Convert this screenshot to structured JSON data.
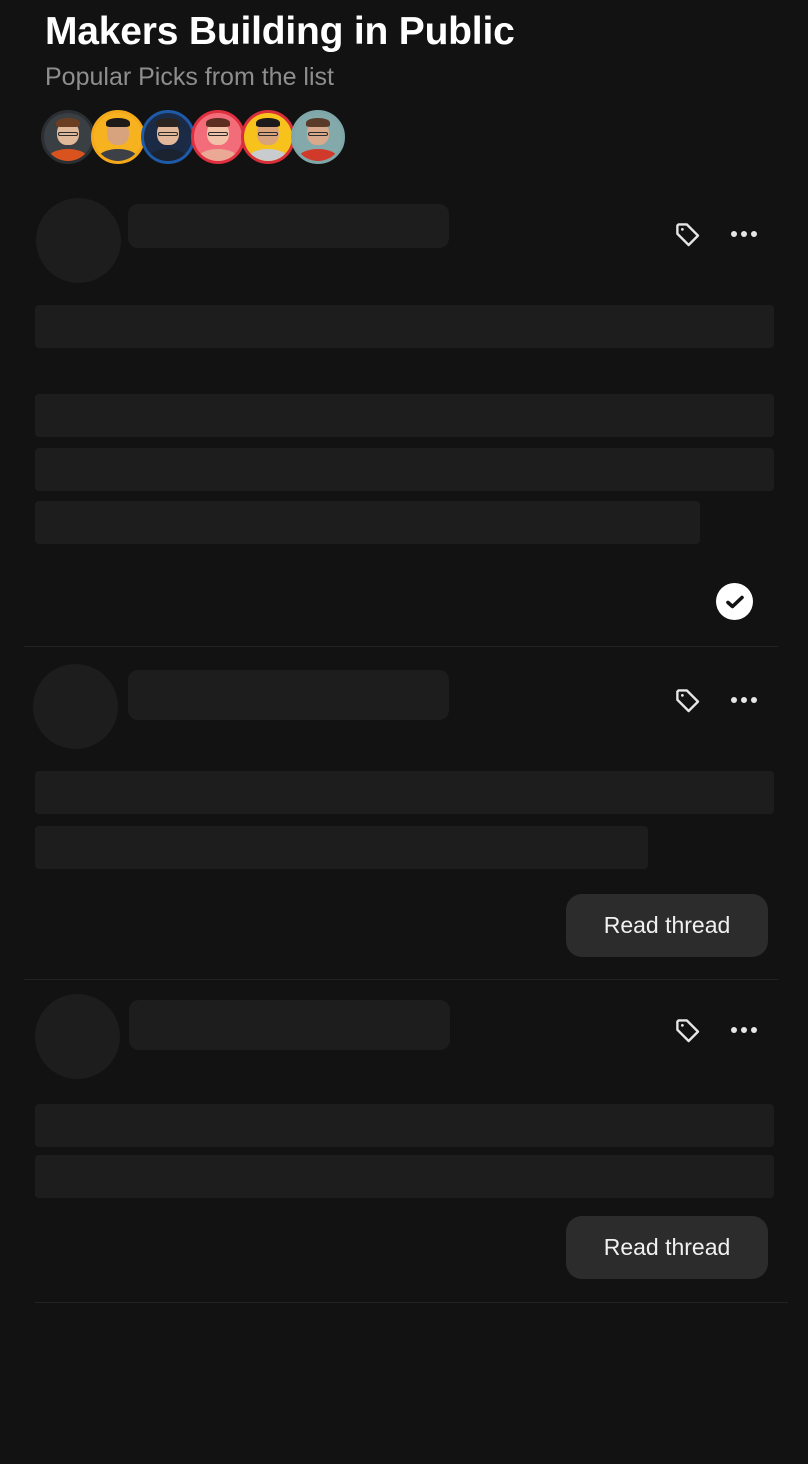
{
  "header": {
    "title": "Makers Building in Public",
    "subtitle": "Popular Picks from the list"
  },
  "avatars": [
    {
      "name": "member-1",
      "ring": "#2b2f33",
      "bg": "#3a3f44",
      "skin": "#e0b89a",
      "hair": "#6b3e22",
      "shirt": "#d9531e",
      "glasses": true
    },
    {
      "name": "member-2",
      "ring": "#f6a81b",
      "bg": "#f7b31f",
      "skin": "#d7a37f",
      "hair": "#1e1a18",
      "shirt": "#3d4147",
      "glasses": false
    },
    {
      "name": "member-3",
      "ring": "#1e5aa8",
      "bg": "#1c2b45",
      "skin": "#e2b79a",
      "hair": "#2a2320",
      "shirt": "#1b2330",
      "glasses": true
    },
    {
      "name": "member-4",
      "ring": "#e0303f",
      "bg": "#f26c7a",
      "skin": "#f1c2a8",
      "hair": "#5c2d20",
      "shirt": "#e9a995",
      "glasses": true
    },
    {
      "name": "member-5",
      "ring": "#d8303a",
      "bg": "#f8c21c",
      "skin": "#d9a37c",
      "hair": "#1c1a1a",
      "shirt": "#c9ccce",
      "glasses": true
    },
    {
      "name": "member-6",
      "ring": "#7fa6a8",
      "bg": "#83a9ab",
      "skin": "#d9a98b",
      "hair": "#5a3b2a",
      "shirt": "#d13a2a",
      "glasses": true
    }
  ],
  "posts": [
    {
      "id": "post-1",
      "action": "check",
      "action_label": ""
    },
    {
      "id": "post-2",
      "action": "button",
      "action_label": "Read thread"
    },
    {
      "id": "post-3",
      "action": "button",
      "action_label": "Read thread"
    }
  ],
  "icons": {
    "tag": "tag-icon",
    "more": "more-horizontal-icon",
    "check": "check-circle-icon"
  },
  "colors": {
    "background": "#121212",
    "skeleton": "#1d1d1d",
    "button_bg": "#2c2c2c",
    "subtitle": "#8e8e8e"
  }
}
